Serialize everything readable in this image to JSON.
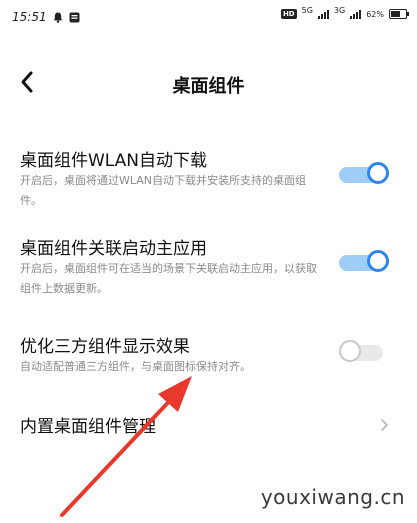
{
  "status_bar": {
    "time": "15:51",
    "network_1": "5G",
    "network_2": "3G",
    "battery": "62%",
    "battery_level": 0.62,
    "hd_badge": "HD",
    "icons": [
      "bell-icon",
      "notification-icon",
      "hd-icon",
      "signal-icon",
      "battery-icon"
    ]
  },
  "header": {
    "title": "桌面组件",
    "back_icon": "chevron-left-icon"
  },
  "settings": [
    {
      "title": "桌面组件WLAN自动下载",
      "description": "开启后，桌面将通过WLAN自动下载并安装所支持的桌面组件。",
      "control": "toggle",
      "enabled": true
    },
    {
      "title": "桌面组件关联启动主应用",
      "description": "开启后，桌面组件可在适当的场景下关联启动主应用，以获取组件上数据更新。",
      "control": "toggle",
      "enabled": true
    },
    {
      "title": "优化三方组件显示效果",
      "description": "自动适配普通三方组件，与桌面图标保持对齐。",
      "control": "toggle",
      "enabled": false
    },
    {
      "title": "内置桌面组件管理",
      "control": "chevron",
      "icon": "chevron-right-icon"
    }
  ],
  "watermark": "youxiwang.cn",
  "colors": {
    "accent": "#2e87e8",
    "toggle_on_track": "#9fcdf7",
    "annotation_arrow": "#e8392c",
    "description_text": "#8a8a8a"
  }
}
